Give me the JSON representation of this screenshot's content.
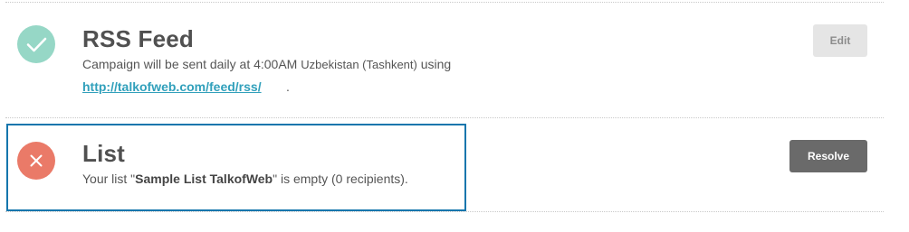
{
  "rss": {
    "status_icon": "check-icon",
    "title": "RSS Feed",
    "description": "Campaign will be sent daily at 4:00AM",
    "timezone": "Uzbekistan (Tashkent)",
    "description_suffix": "using",
    "feed_url": "http://talkofweb.com/feed/rss/",
    "period": ".",
    "button_label": "Edit"
  },
  "list": {
    "status_icon": "close-icon",
    "title": "List",
    "description_prefix": "Your list \"",
    "list_name": "Sample List TalkofWeb",
    "description_suffix": "\" is empty (0 recipients).",
    "button_label": "Resolve"
  },
  "colors": {
    "success": "#96d7c6",
    "error": "#ea7a68",
    "link": "#31a0bb",
    "highlight": "#1576ad"
  }
}
